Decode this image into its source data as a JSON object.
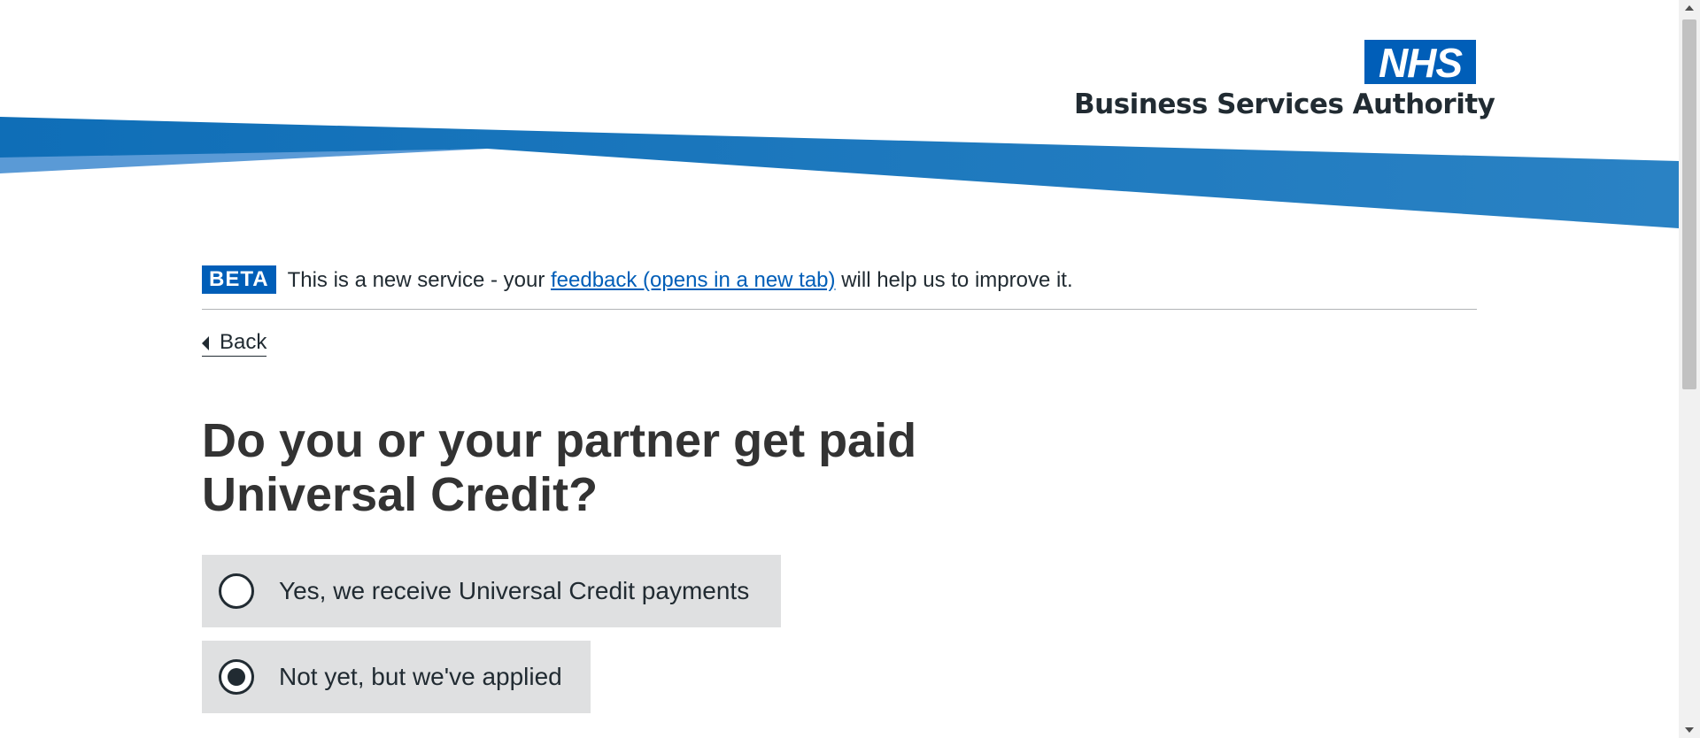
{
  "header": {
    "logo_text": "NHS",
    "org_name": "Business Services Authority",
    "banner_colors": {
      "primary": "#1276bc",
      "light": "#5a9ad6"
    },
    "logo_color": "#005eb8"
  },
  "phase_banner": {
    "tag": "BETA",
    "text_before": "This is a new service - your ",
    "link_text": "feedback (opens in a new tab)",
    "text_after": " will help us to improve it."
  },
  "navigation": {
    "back_label": "Back"
  },
  "form": {
    "question": "Do you or your partner get paid Universal Credit?",
    "options": [
      {
        "label": "Yes, we receive Universal Credit payments",
        "selected": false
      },
      {
        "label": "Not yet, but we've applied",
        "selected": true
      }
    ]
  },
  "colors": {
    "accent": "#005eb8",
    "text": "#212b32",
    "option_background": "#dfe0e1"
  }
}
